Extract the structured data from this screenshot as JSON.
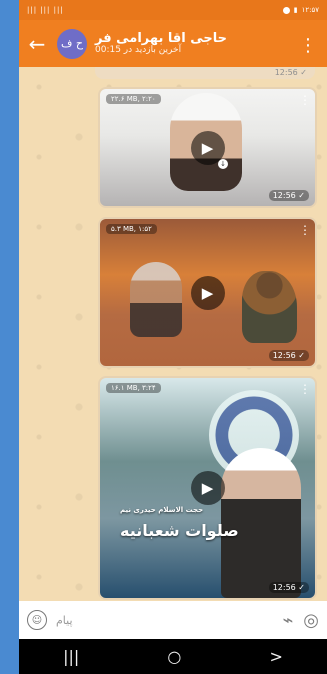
{
  "status_bar": {
    "left_text": "||| ||| |||",
    "right_time": "۱۲:۵۷"
  },
  "header": {
    "avatar_text": "ح ف",
    "title": "حاجی اقا بهرامی فر",
    "subtitle": "آخرین بازدید در 00:15",
    "back_icon": "←",
    "menu_icon": "⋮"
  },
  "messages": [
    {
      "size": "۲۲.۶ MB, ۲:۲۰",
      "time": "12:56",
      "status": "✓"
    },
    {
      "size": "۵.۳ MB, ۱:۵۲",
      "time": "12:56",
      "status": "✓"
    },
    {
      "size": "۱۶.۱ MB, ۳:۲۴",
      "time": "12:56",
      "status": "✓",
      "caption_top": "حجت الاسلام حیدری نیم",
      "caption_main": "صلوات شعبانیه"
    }
  ],
  "composer": {
    "placeholder": "پیام"
  },
  "nav": {
    "recent_icon": "|||",
    "home_icon": "○",
    "back_icon": ">"
  }
}
